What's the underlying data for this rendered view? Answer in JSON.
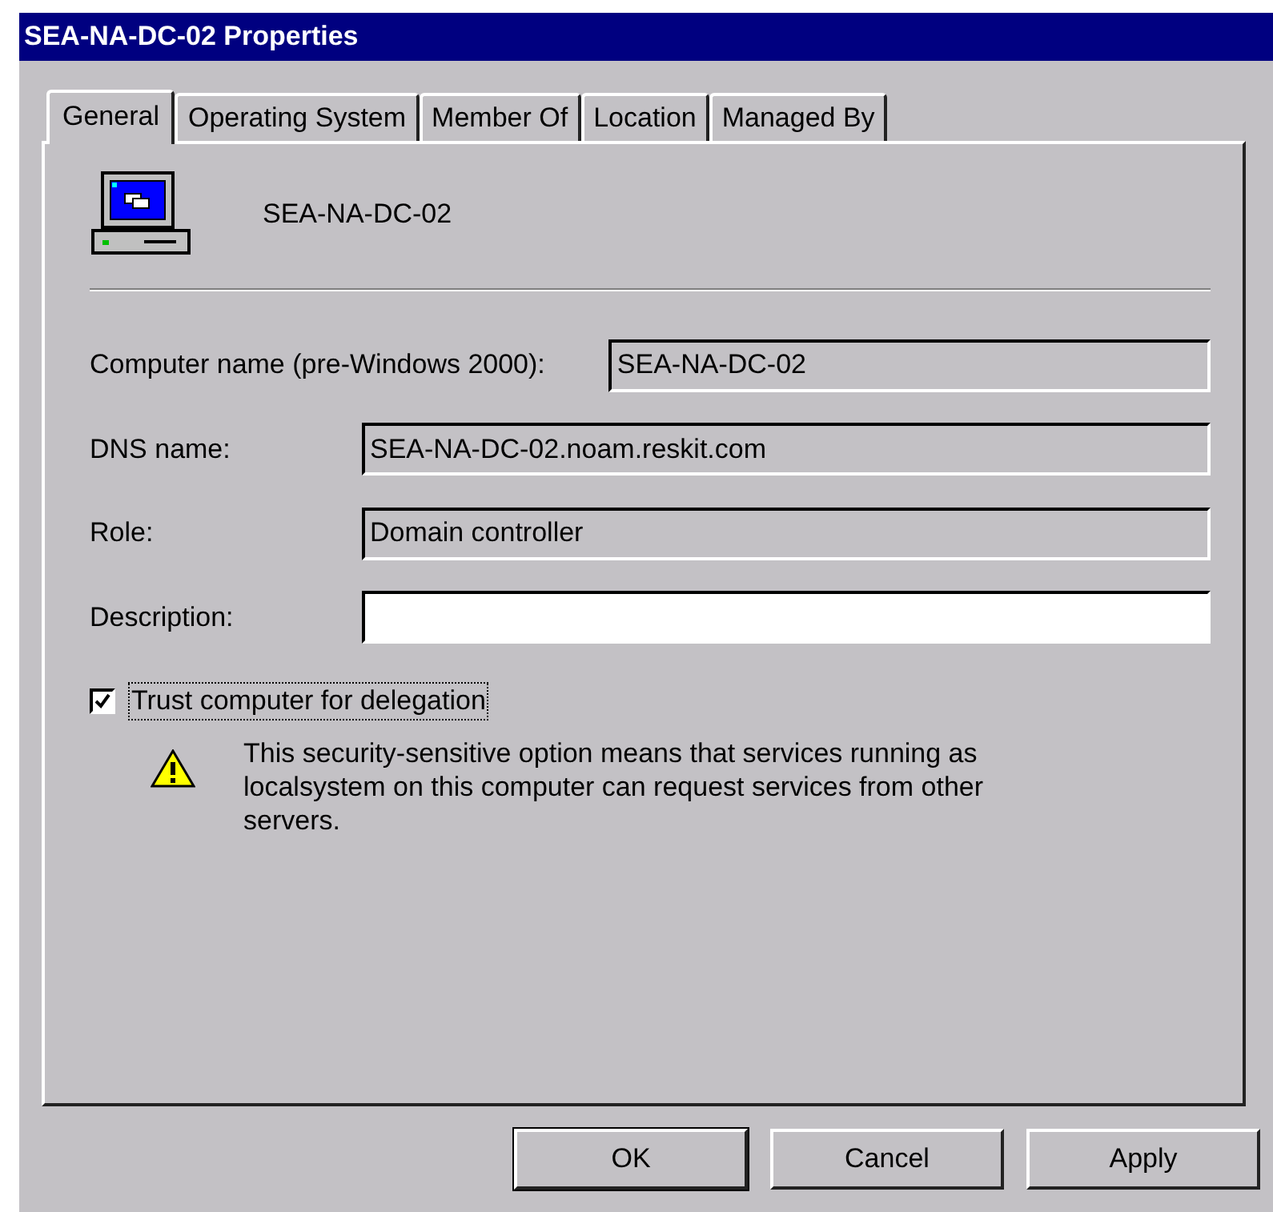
{
  "window": {
    "title": "SEA-NA-DC-02 Properties"
  },
  "tabs": [
    {
      "label": "General",
      "selected": true
    },
    {
      "label": "Operating System",
      "selected": false
    },
    {
      "label": "Member Of",
      "selected": false
    },
    {
      "label": "Location",
      "selected": false
    },
    {
      "label": "Managed By",
      "selected": false
    }
  ],
  "header": {
    "name": "SEA-NA-DC-02"
  },
  "fields": [
    {
      "label": "Computer name (pre-Windows 2000):",
      "value": "SEA-NA-DC-02",
      "disabled": true
    },
    {
      "label": "DNS name:",
      "value": "SEA-NA-DC-02.noam.reskit.com",
      "disabled": true
    },
    {
      "label": "Role:",
      "value": "Domain controller",
      "disabled": true
    },
    {
      "label": "Description:",
      "disabled": false
    }
  ],
  "trust": {
    "label": "Trust computer for delegation",
    "checked": true,
    "focused": true
  },
  "warning": "This security-sensitive option means that services running as localsystem on this computer can request services from other servers.",
  "buttons": [
    {
      "label": "OK",
      "default": true
    },
    {
      "label": "Cancel",
      "default": false
    },
    {
      "label": "Apply",
      "default": false
    }
  ]
}
